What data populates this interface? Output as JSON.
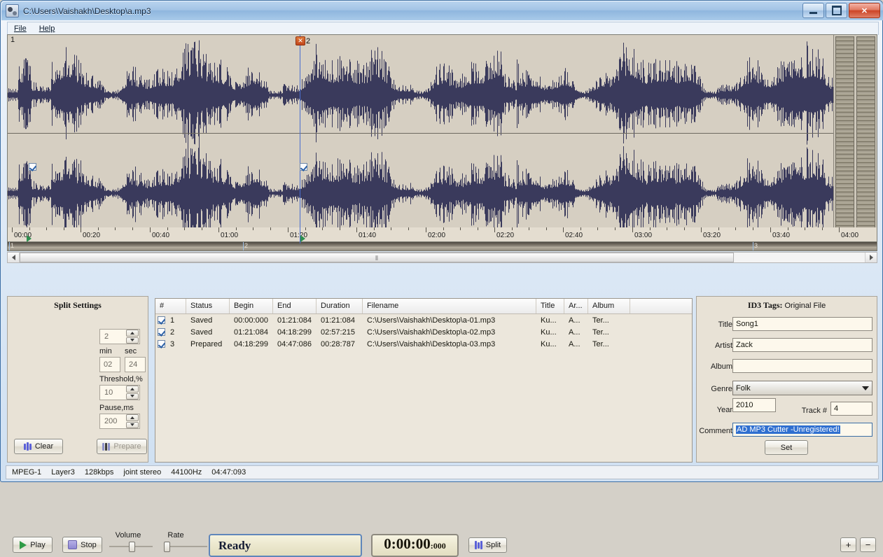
{
  "window": {
    "title": "C:\\Users\\Vaishakh\\Desktop\\a.mp3",
    "icon": "app-icon",
    "minimize": "—",
    "maximize": "□",
    "close": "✕"
  },
  "menu": {
    "items": [
      {
        "label": "File"
      },
      {
        "label": "Help"
      }
    ]
  },
  "waveform": {
    "region_label_left": "1",
    "marker_label": "2",
    "marker_icon": "✕",
    "channel_checkbox_left": "checked",
    "channel_checkbox_marker": "checked"
  },
  "ruler": {
    "ticks": [
      "00:00",
      "00:20",
      "00:40",
      "01:00",
      "01:20",
      "01:40",
      "02:00",
      "02:20",
      "02:40",
      "03:00",
      "03:20",
      "03:40",
      "04:00"
    ]
  },
  "overview": {
    "markers": [
      {
        "label": "1",
        "pos": 0.0
      },
      {
        "label": "2",
        "pos": 0.283
      },
      {
        "label": "3",
        "pos": 0.9
      }
    ]
  },
  "toolbar": {
    "play_label": "Play",
    "stop_label": "Stop",
    "volume_label": "Volume",
    "rate_label": "Rate",
    "status_text": "Ready",
    "time_main": "0:00:00",
    "time_ms": ":000",
    "split_label": "Split",
    "zoom_in": "+",
    "zoom_out": "−"
  },
  "split_settings": {
    "title": "Split Settings",
    "pieces_value": "2",
    "min_label": "min",
    "sec_label": "sec",
    "min_value": "02",
    "sec_value": "24",
    "threshold_label": "Threshold,%",
    "threshold_value": "10",
    "pause_label": "Pause,ms",
    "pause_value": "200",
    "clear_label": "Clear",
    "prepare_label": "Prepare"
  },
  "file_list": {
    "columns": [
      "#",
      "Status",
      "Begin",
      "End",
      "Duration",
      "Filename",
      "Title",
      "Ar...",
      "Album"
    ],
    "rows": [
      {
        "num": "1",
        "status": "Saved",
        "begin": "00:00:000",
        "end": "01:21:084",
        "duration": "01:21:084",
        "filename": "C:\\Users\\Vaishakh\\Desktop\\a-01.mp3",
        "title": "Ku...",
        "artist": "A...",
        "album": "Ter...",
        "checked": true
      },
      {
        "num": "2",
        "status": "Saved",
        "begin": "01:21:084",
        "end": "04:18:299",
        "duration": "02:57:215",
        "filename": "C:\\Users\\Vaishakh\\Desktop\\a-02.mp3",
        "title": "Ku...",
        "artist": "A...",
        "album": "Ter...",
        "checked": true
      },
      {
        "num": "3",
        "status": "Prepared",
        "begin": "04:18:299",
        "end": "04:47:086",
        "duration": "00:28:787",
        "filename": "C:\\Users\\Vaishakh\\Desktop\\a-03.mp3",
        "title": "Ku...",
        "artist": "A...",
        "album": "Ter...",
        "checked": true
      }
    ]
  },
  "id3": {
    "title_prefix": "ID3 Tags:",
    "title_suffix": "Original File",
    "title_label": "Title",
    "title_value": "Song1",
    "artist_label": "Artist",
    "artist_value": "Zack",
    "album_label": "Album",
    "album_value": "",
    "genre_label": "Genre",
    "genre_value": "Folk",
    "year_label": "Year",
    "year_value": "2010",
    "track_label": "Track #",
    "track_value": "4",
    "comment_label": "Comment",
    "comment_value": "AD MP3 Cutter -Unregistered!",
    "set_label": "Set"
  },
  "statusbar": {
    "format": "MPEG-1",
    "layer": "Layer3",
    "bitrate": "128kbps",
    "mode": "joint stereo",
    "samplerate": "44100Hz",
    "length": "04:47:093"
  }
}
